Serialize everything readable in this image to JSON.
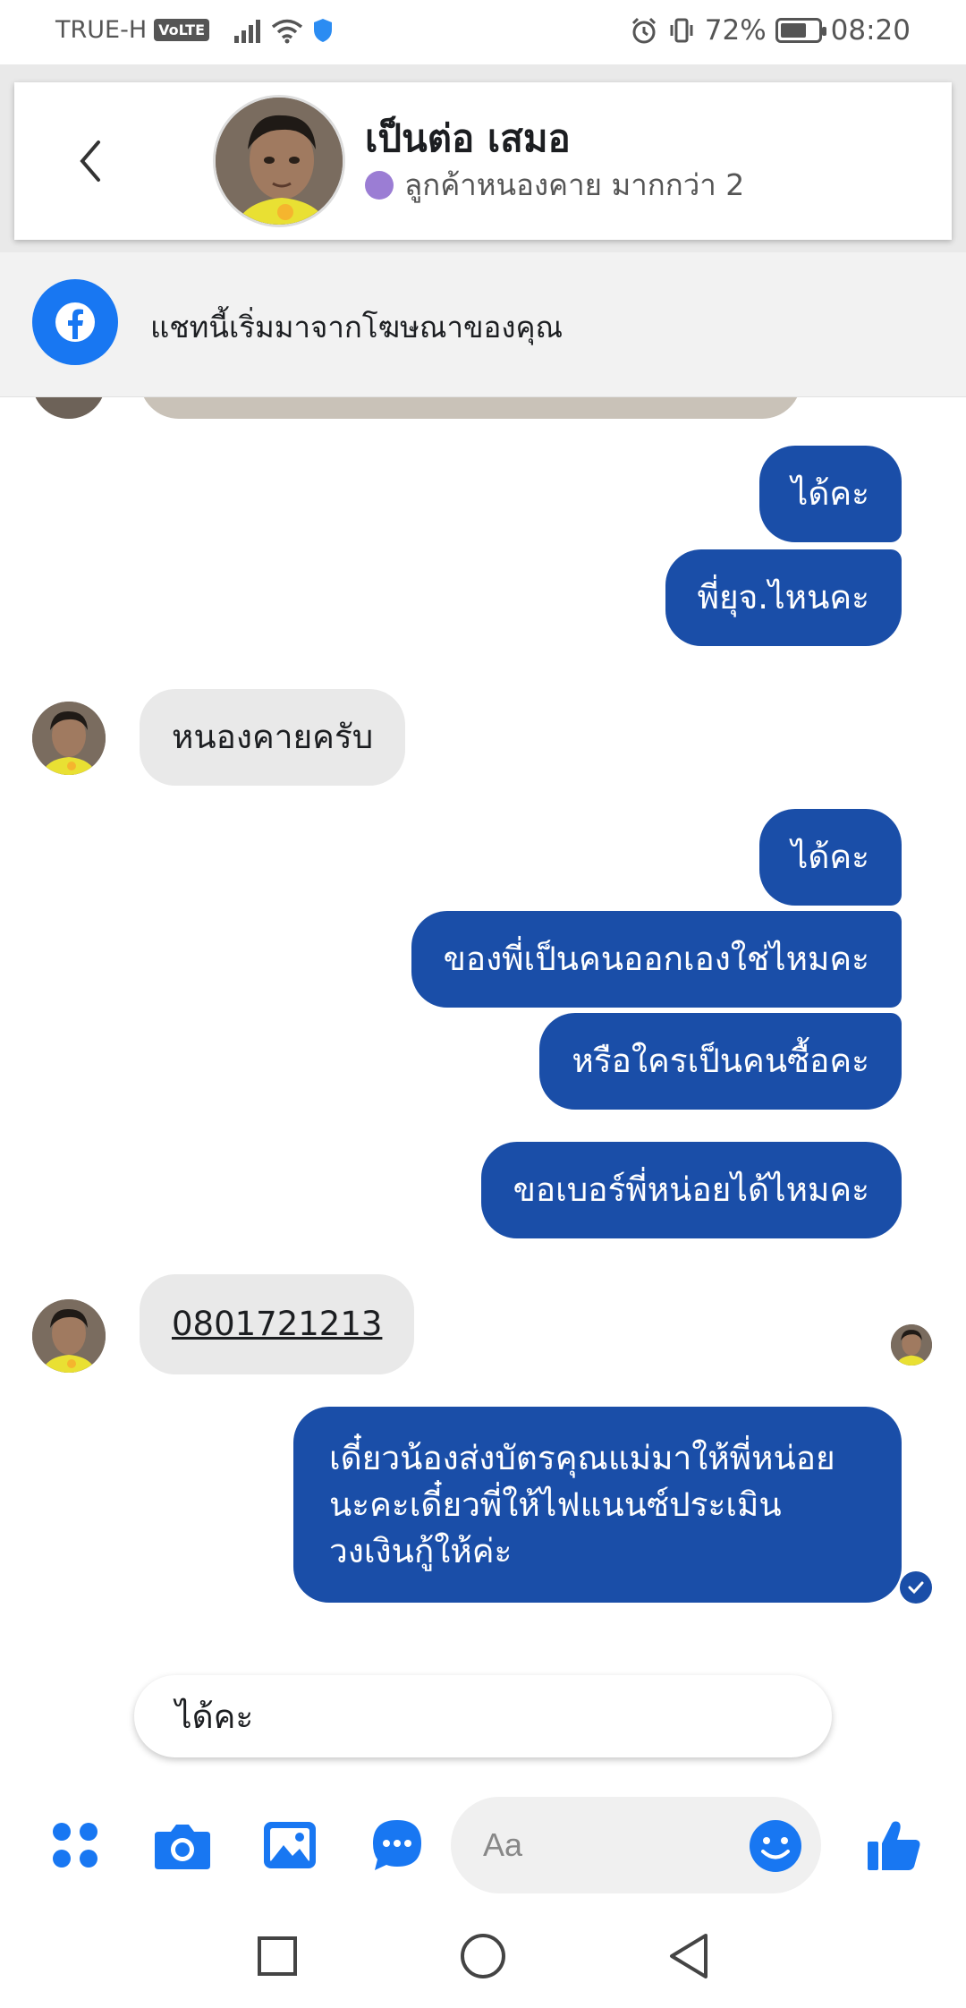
{
  "status_bar": {
    "carrier": "TRUE-H",
    "volte": "VoLTE",
    "battery": "72%",
    "battery_level": 0.72,
    "time": "08:20"
  },
  "header": {
    "name": "เป็นต่อ เสมอ",
    "subtitle": "ลูกค้าหนองคาย มากกว่า 2",
    "label_color": "#9b7dd4"
  },
  "ad_banner": {
    "text": "แชทนี้เริ่มมาจากโฆษณาของคุณ"
  },
  "messages": [
    {
      "from": "me",
      "text": "ได้คะ"
    },
    {
      "from": "me",
      "text": "พี่ยุจ.ไหนคะ"
    },
    {
      "from": "them",
      "text": "หนองคายครับ"
    },
    {
      "from": "me",
      "text": "ได้คะ"
    },
    {
      "from": "me",
      "text": "ของพี่เป็นคนออกเองใช่ไหมคะ"
    },
    {
      "from": "me",
      "text": "หรือใครเป็นคนซื้อคะ"
    },
    {
      "from": "me",
      "text": "ขอเบอร์พี่หน่อยได้ไหมคะ"
    },
    {
      "from": "them",
      "text": "0801721213"
    },
    {
      "from": "me",
      "text": "เดี๋ยวน้องส่งบัตรคุณแม่มาให้พี่หน่อย นะคะเดี๋ยวพี่ให้ไฟแนนซ์ประเมิน วงเงินกู้ให้ค่ะ"
    }
  ],
  "quick_reply": {
    "text": "ได้คะ"
  },
  "composer": {
    "placeholder": "Aa",
    "icons": [
      "menu-dots-icon",
      "camera-icon",
      "gallery-icon",
      "chat-bubble-icon",
      "emoji-icon",
      "thumbs-up-icon"
    ]
  },
  "colors": {
    "outgoing_bubble": "#1a4ea8",
    "incoming_bubble": "#e9e9e9",
    "accent": "#1877f2"
  }
}
